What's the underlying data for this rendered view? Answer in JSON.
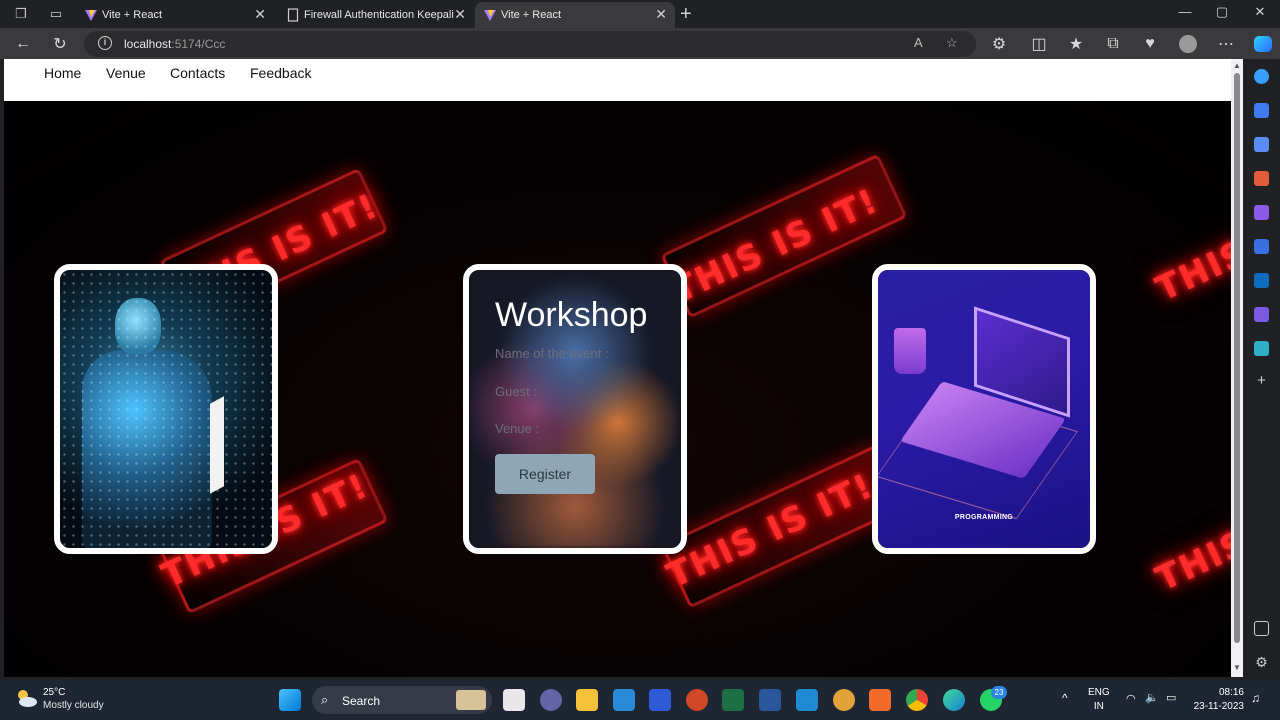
{
  "browser": {
    "tabs": [
      {
        "title": "Vite + React",
        "active": false
      },
      {
        "title": "Firewall Authentication Keepaliv",
        "active": false
      },
      {
        "title": "Vite + React",
        "active": true
      }
    ],
    "new_tab_glyph": "+",
    "url_host": "localhost",
    "url_path": ":5174/Ccc",
    "window_controls": {
      "minimize": "—",
      "maximize": "▢",
      "close": "✕"
    }
  },
  "page": {
    "nav": {
      "links": [
        "Home",
        "Venue",
        "Contacts",
        "Feedback"
      ]
    },
    "hero": {
      "neon_text": [
        "THIS IS IT!",
        "THIS IS IT!",
        "THIS IS IT!",
        "THIS IS IT!",
        "THIS",
        "THIS"
      ]
    },
    "form_card": {
      "title": "Workshop",
      "labels": [
        "Name of the event :",
        "Guest :",
        "Venue :"
      ],
      "button": "Register"
    },
    "right_card": {
      "caption": "PROGRAMMING"
    }
  },
  "taskbar": {
    "weather_temp": "25°C",
    "weather_desc": "Mostly cloudy",
    "search_placeholder": "Search",
    "lang_top": "ENG",
    "lang_bottom": "IN",
    "time": "08:16",
    "date": "23-11-2023",
    "whatsapp_badge": "23"
  },
  "colors": {
    "accent": "#ff2a2a",
    "register_button": "#8fa6b6",
    "taskbar": "#1f2633"
  }
}
